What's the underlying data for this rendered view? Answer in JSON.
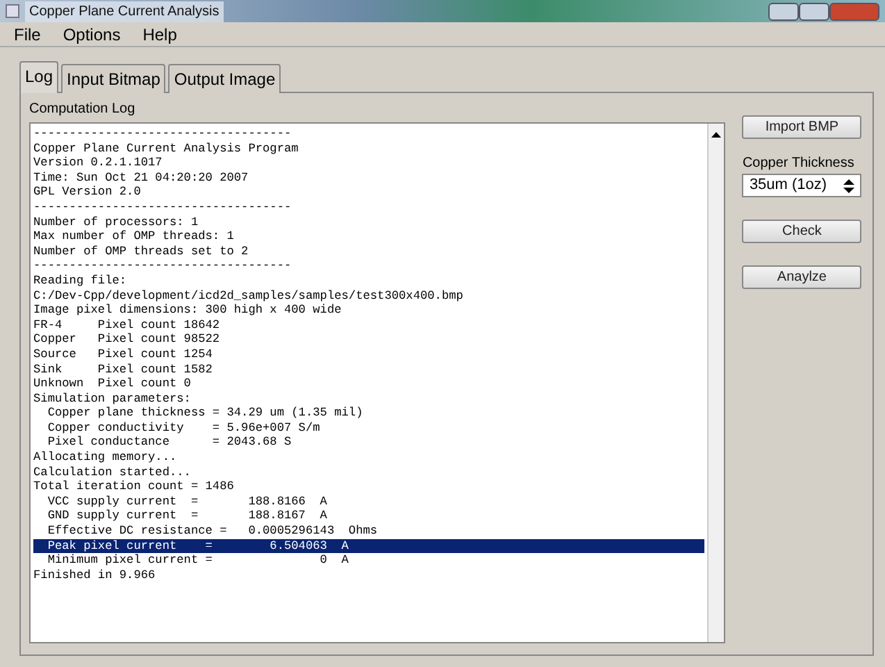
{
  "window": {
    "title": "Copper Plane Current Analysis"
  },
  "menu": [
    "File",
    "Options",
    "Help"
  ],
  "tabs": [
    {
      "label": "Log",
      "selected": true
    },
    {
      "label": "Input Bitmap",
      "selected": false
    },
    {
      "label": "Output Image",
      "selected": false
    }
  ],
  "log": {
    "label": "Computation Log",
    "lines": [
      {
        "text": "------------------------------------",
        "selected": false
      },
      {
        "text": "Copper Plane Current Analysis Program",
        "selected": false
      },
      {
        "text": "Version 0.2.1.1017",
        "selected": false
      },
      {
        "text": "Time: Sun Oct 21 04:20:20 2007",
        "selected": false
      },
      {
        "text": "GPL Version 2.0",
        "selected": false
      },
      {
        "text": "------------------------------------",
        "selected": false
      },
      {
        "text": "Number of processors: 1",
        "selected": false
      },
      {
        "text": "Max number of OMP threads: 1",
        "selected": false
      },
      {
        "text": "Number of OMP threads set to 2",
        "selected": false
      },
      {
        "text": "------------------------------------",
        "selected": false
      },
      {
        "text": "Reading file:",
        "selected": false
      },
      {
        "text": "C:/Dev-Cpp/development/icd2d_samples/samples/test300x400.bmp",
        "selected": false
      },
      {
        "text": "Image pixel dimensions: 300 high x 400 wide",
        "selected": false
      },
      {
        "text": "FR-4     Pixel count 18642",
        "selected": false
      },
      {
        "text": "Copper   Pixel count 98522",
        "selected": false
      },
      {
        "text": "Source   Pixel count 1254",
        "selected": false
      },
      {
        "text": "Sink     Pixel count 1582",
        "selected": false
      },
      {
        "text": "Unknown  Pixel count 0",
        "selected": false
      },
      {
        "text": "Simulation parameters:",
        "selected": false
      },
      {
        "text": "  Copper plane thickness = 34.29 um (1.35 mil)",
        "selected": false
      },
      {
        "text": "  Copper conductivity    = 5.96e+007 S/m",
        "selected": false
      },
      {
        "text": "  Pixel conductance      = 2043.68 S",
        "selected": false
      },
      {
        "text": "Allocating memory...",
        "selected": false
      },
      {
        "text": "Calculation started...",
        "selected": false
      },
      {
        "text": "Total iteration count = 1486",
        "selected": false
      },
      {
        "text": "  VCC supply current  =       188.8166  A",
        "selected": false
      },
      {
        "text": "  GND supply current  =       188.8167  A",
        "selected": false
      },
      {
        "text": "  Effective DC resistance =   0.0005296143  Ohms",
        "selected": false
      },
      {
        "text": "  Peak pixel current    =        6.504063  A",
        "selected": true
      },
      {
        "text": "  Minimum pixel current =               0  A",
        "selected": false
      },
      {
        "text": "Finished in 9.966",
        "selected": false
      }
    ]
  },
  "side": {
    "import_button": "Import BMP",
    "thickness_label": "Copper Thickness",
    "thickness_value": "35um (1oz)",
    "check_button": "Check",
    "analyze_button": "Anaylze"
  }
}
